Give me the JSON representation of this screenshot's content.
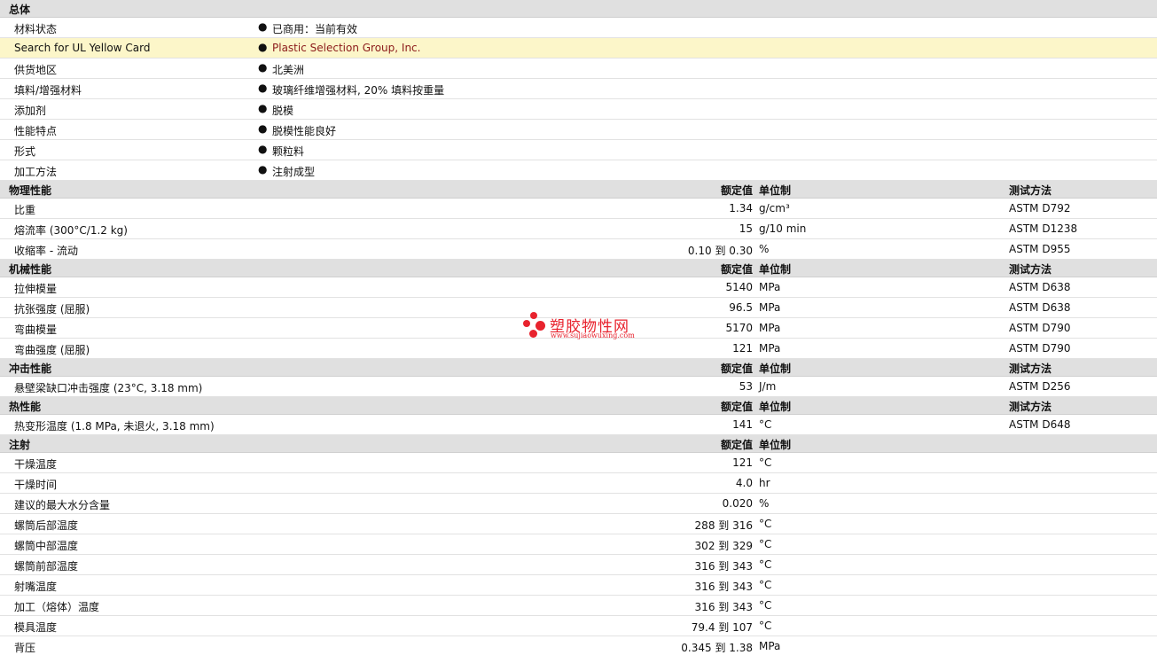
{
  "general": {
    "title": "总体",
    "rows": [
      {
        "label": "材料状态",
        "value": "已商用：当前有效"
      },
      {
        "label": "Search for UL Yellow Card",
        "value": "Plastic Selection Group, Inc."
      },
      {
        "label": "供货地区",
        "value": "北美洲"
      },
      {
        "label": "填料/增强材料",
        "value": "玻璃纤维增强材料, 20% 填料按重量"
      },
      {
        "label": "添加剂",
        "value": "脱模"
      },
      {
        "label": "性能特点",
        "value": "脱模性能良好"
      },
      {
        "label": "形式",
        "value": "颗粒料"
      },
      {
        "label": "加工方法",
        "value": "注射成型"
      }
    ]
  },
  "columns": {
    "rated": "额定值",
    "unit": "单位制",
    "test": "测试方法"
  },
  "physical": {
    "title": "物理性能",
    "rows": [
      {
        "label": "比重",
        "value": "1.34",
        "unit": "g/cm³",
        "test": "ASTM D792"
      },
      {
        "label": "熔流率  (300°C/1.2 kg)",
        "value": "15",
        "unit": "g/10 min",
        "test": "ASTM D1238"
      },
      {
        "label": "收缩率  - 流动",
        "value": "0.10 到  0.30",
        "unit": "%",
        "test": "ASTM D955"
      }
    ]
  },
  "mechanical": {
    "title": "机械性能",
    "rows": [
      {
        "label": "拉伸模量",
        "value": "5140",
        "unit": "MPa",
        "test": "ASTM D638"
      },
      {
        "label": "抗张强度  (屈服)",
        "value": "96.5",
        "unit": "MPa",
        "test": "ASTM D638"
      },
      {
        "label": "弯曲模量",
        "value": "5170",
        "unit": "MPa",
        "test": "ASTM D790"
      },
      {
        "label": "弯曲强度  (屈服)",
        "value": "121",
        "unit": "MPa",
        "test": "ASTM D790"
      }
    ]
  },
  "impact": {
    "title": "冲击性能",
    "rows": [
      {
        "label": "悬壁梁缺口冲击强度  (23°C, 3.18 mm)",
        "value": "53",
        "unit": "J/m",
        "test": "ASTM D256"
      }
    ]
  },
  "thermal": {
    "title": "热性能",
    "rows": [
      {
        "label": "热变形温度  (1.8 MPa, 未退火, 3.18 mm)",
        "value": "141",
        "unit": "°C",
        "test": "ASTM D648"
      }
    ]
  },
  "injection": {
    "title": "注射",
    "rows": [
      {
        "label": "干燥温度",
        "value": "121",
        "unit": "°C"
      },
      {
        "label": "干燥时间",
        "value": "4.0",
        "unit": "hr"
      },
      {
        "label": "建议的最大水分含量",
        "value": "0.020",
        "unit": "%"
      },
      {
        "label": "螺筒后部温度",
        "value": "288 到  316",
        "unit": "°C"
      },
      {
        "label": "螺筒中部温度",
        "value": "302 到  329",
        "unit": "°C"
      },
      {
        "label": "螺筒前部温度",
        "value": "316 到  343",
        "unit": "°C"
      },
      {
        "label": "射嘴温度",
        "value": "316 到  343",
        "unit": "°C"
      },
      {
        "label": "加工（熔体）温度",
        "value": "316 到  343",
        "unit": "°C"
      },
      {
        "label": "模具温度",
        "value": "79.4 到  107",
        "unit": "°C"
      },
      {
        "label": "背压",
        "value": "0.345 到  1.38",
        "unit": "MPa"
      }
    ]
  },
  "watermark": {
    "name": "塑胶物性网",
    "url": "www.sujiaowuxing.com"
  }
}
